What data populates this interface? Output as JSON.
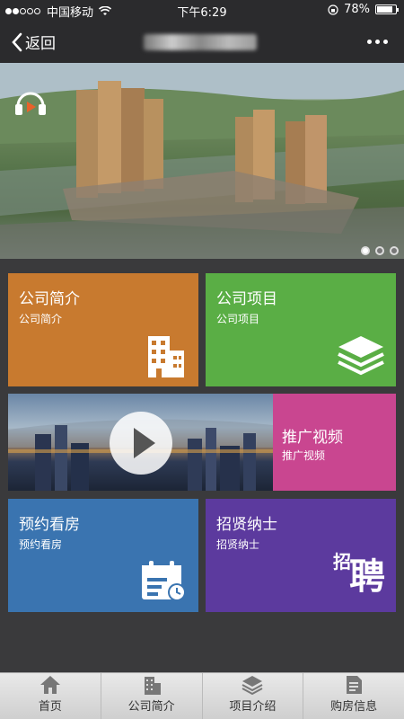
{
  "status": {
    "carrier": "中国移动",
    "time": "下午6:29",
    "battery": "78%",
    "signal_dots_filled": 2
  },
  "nav": {
    "back_label": "返回"
  },
  "banner": {
    "slides": 3,
    "active_slide": 1
  },
  "tiles": [
    {
      "title": "公司简介",
      "subtitle": "公司简介",
      "color": "#c87a2f",
      "icon": "building-icon"
    },
    {
      "title": "公司项目",
      "subtitle": "公司项目",
      "color": "#5aae45",
      "icon": "layers-icon"
    },
    {
      "title": "推广视频",
      "subtitle": "推广视频",
      "color": "#c94690",
      "icon": "play-icon"
    },
    {
      "title": "预约看房",
      "subtitle": "预约看房",
      "color": "#3a74b0",
      "icon": "calendar-icon"
    },
    {
      "title": "招贤纳士",
      "subtitle": "招贤纳士",
      "color": "#5c3a9e",
      "icon": "recruit-icon",
      "icon_text": "聘",
      "icon_small_text": "招"
    }
  ],
  "tabbar": [
    {
      "label": "首页",
      "icon": "home-icon"
    },
    {
      "label": "公司简介",
      "icon": "building-icon"
    },
    {
      "label": "项目介绍",
      "icon": "layers-icon"
    },
    {
      "label": "购房信息",
      "icon": "document-icon"
    }
  ]
}
